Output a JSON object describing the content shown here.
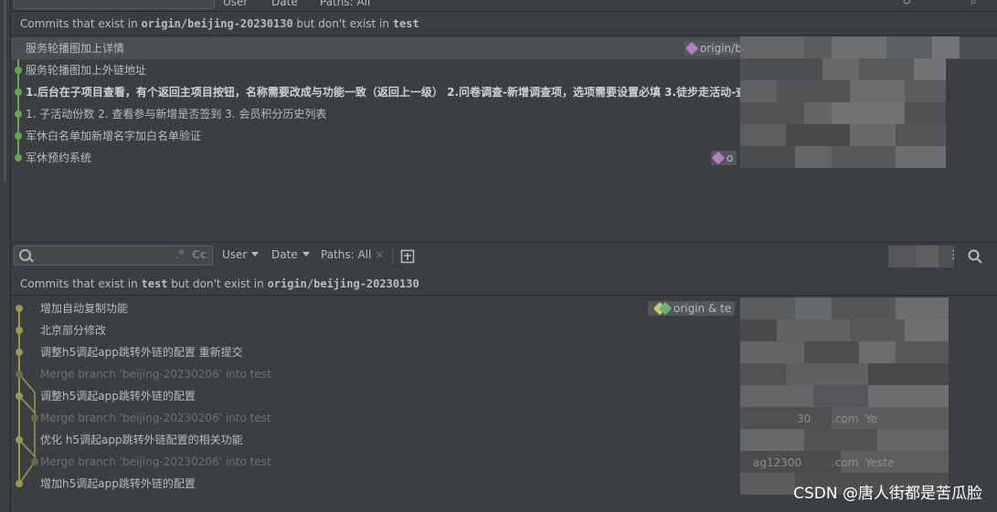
{
  "top_toolbar": {
    "user_label": "User",
    "date_label": "Date",
    "paths_label": "Paths: All"
  },
  "panel1": {
    "header": {
      "prefix": "Commits that exist in",
      "branch_a": "origin/beijing-20230130",
      "middle": "but don't exist in",
      "branch_b": "test"
    },
    "commits": [
      {
        "message": "服务轮播图加上详情",
        "tag": "origin/be"
      },
      {
        "message": "服务轮播图加上外链地址"
      },
      {
        "message": "1.后台在子项目查看，有个返回主项目按钮，名称需要改成与功能一致（返回上一级） 2.问卷调查-新增调查项，选项需要设置必填 3.徒步走活动-查",
        "bold": true
      },
      {
        "message": "1. 子活动份数 2. 查看参与新增是否签到 3. 会员积分历史列表"
      },
      {
        "message": "军休白名单加新增名字加白名单验证"
      },
      {
        "message": "军休预约系统",
        "tag": "o"
      }
    ]
  },
  "filter": {
    "search_placeholder": "",
    "regex_icon": ".*",
    "case_icon": "Cc",
    "user_label": "User",
    "date_label": "Date",
    "paths_label": "Paths: All",
    "paths_clear": "×",
    "new_tab_icon": "new-tab-icon"
  },
  "panel2": {
    "header": {
      "prefix": "Commits that exist in",
      "branch_a": "test",
      "middle": "but don't exist in",
      "branch_b": "origin/beijing-20230130"
    },
    "commits": [
      {
        "message": "增加自动复制功能",
        "tag": "origin & te"
      },
      {
        "message": "北京部分修改"
      },
      {
        "message": "调整h5调起app跳转外链的配置 重新提交"
      },
      {
        "message": "Merge branch 'beijing-20230206' into test",
        "merge": true
      },
      {
        "message": "调整h5调起app跳转外链的配置"
      },
      {
        "message": "Merge branch 'beijing-20230206' into test",
        "merge": true
      },
      {
        "message": "优化 h5调起app跳转外链配置的相关功能"
      },
      {
        "message": "Merge branch 'beijing-20230206' into test",
        "merge": true
      },
      {
        "message": "增加h5调起app跳转外链的配置"
      }
    ],
    "blurred_fragments": [
      "30",
      ".com",
      "Ye",
      "ag12300",
      ".com",
      "Yeste"
    ]
  },
  "watermark": "CSDN @唐人街都是苦瓜脸",
  "colors": {
    "background": "#3c3f41",
    "selected_row": "#4b4f52",
    "graph_green": "#5faa4a",
    "graph_olive": "#9a9a4e",
    "tag_purple": "#b07fc4",
    "tag_yellow": "#c9c86a"
  }
}
